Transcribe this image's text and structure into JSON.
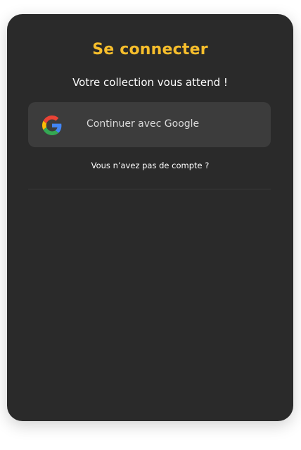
{
  "login": {
    "title": "Se connecter",
    "subtitle": "Votre collection vous attend !",
    "google_button_label": "Continuer avec Google",
    "google_icon": "google-icon",
    "signup_prompt": "Vous n’avez pas de compte ?"
  },
  "colors": {
    "accent": "#f7be2c",
    "card_background": "#2a2a2a",
    "button_background": "#3c3c3c"
  }
}
